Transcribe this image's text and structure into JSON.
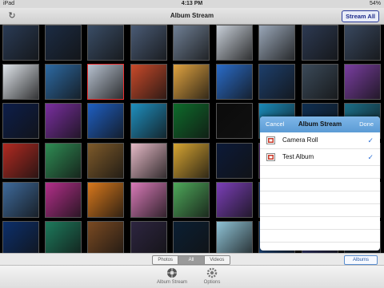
{
  "status_bar": {
    "device": "iPad",
    "time": "4:13 PM",
    "battery": "54%"
  },
  "nav": {
    "title": "Album Stream",
    "stream_all_label": "Stream All"
  },
  "photo_grid": {
    "rows": [
      [
        "#2a3b55",
        "#1c2c44",
        "#3a4d66",
        "#4a5b75",
        "#6f7f94",
        "#c8cfd8",
        "#9aa7b8",
        "#2d3a52",
        "#39485f"
      ],
      [
        "#dfe4ea",
        "#2d6aa3",
        "#b7c1cf",
        "#c94a2a",
        "#e1a340",
        "#2a6cc9",
        "#1d3f6c",
        "#3b4a59",
        "#7a3ea1"
      ],
      [
        "#0d1e4a",
        "#7a2fa0",
        "#1f5fc2",
        "#1f8fbf",
        "#0e6b2b",
        "#0b0b0b",
        "#1a8ab8",
        "#0f2f52",
        "#1b6e88"
      ],
      [
        "#b22a21",
        "#2f8c54",
        "#7e5a2a",
        "#e5b9c6",
        "#d6a432",
        "#0c1a38",
        "#5a2c8a",
        "#1a3f7a",
        "#162d5a"
      ],
      [
        "#3e6a9b",
        "#b32f8a",
        "#d8781c",
        "#d97ab8",
        "#4ea85a",
        "#7b3fb8",
        "#1e4da1",
        "#2a5da0",
        "#0e3e6a"
      ],
      [
        "#0c2f6b",
        "#1d7a5c",
        "#7a4a22",
        "#2d2540",
        "#0b1f33",
        "#8fc3d6",
        "#1e5aa6",
        "#3a3f8a",
        "#1a2a3a"
      ]
    ],
    "selected_tile": {
      "row": 1,
      "col": 2
    }
  },
  "album_popover": {
    "cancel_label": "Cancel",
    "title": "Album Stream",
    "done_label": "Done",
    "items": [
      {
        "label": "Camera Roll",
        "checked": "✓"
      },
      {
        "label": "Test Album",
        "checked": "✓"
      }
    ]
  },
  "filter": {
    "options": [
      "Photos",
      "All",
      "Videos"
    ],
    "selected": "All"
  },
  "albums_button_label": "Albums",
  "tab_bar": {
    "tabs": [
      {
        "label": "Album Stream",
        "icon": "album-stream-icon"
      },
      {
        "label": "Options",
        "icon": "gear-icon"
      }
    ]
  },
  "colors": {
    "accent": "#2b6fd6",
    "popover_header": "#5b9bd5",
    "nav_button_border": "#2a3a9a"
  }
}
